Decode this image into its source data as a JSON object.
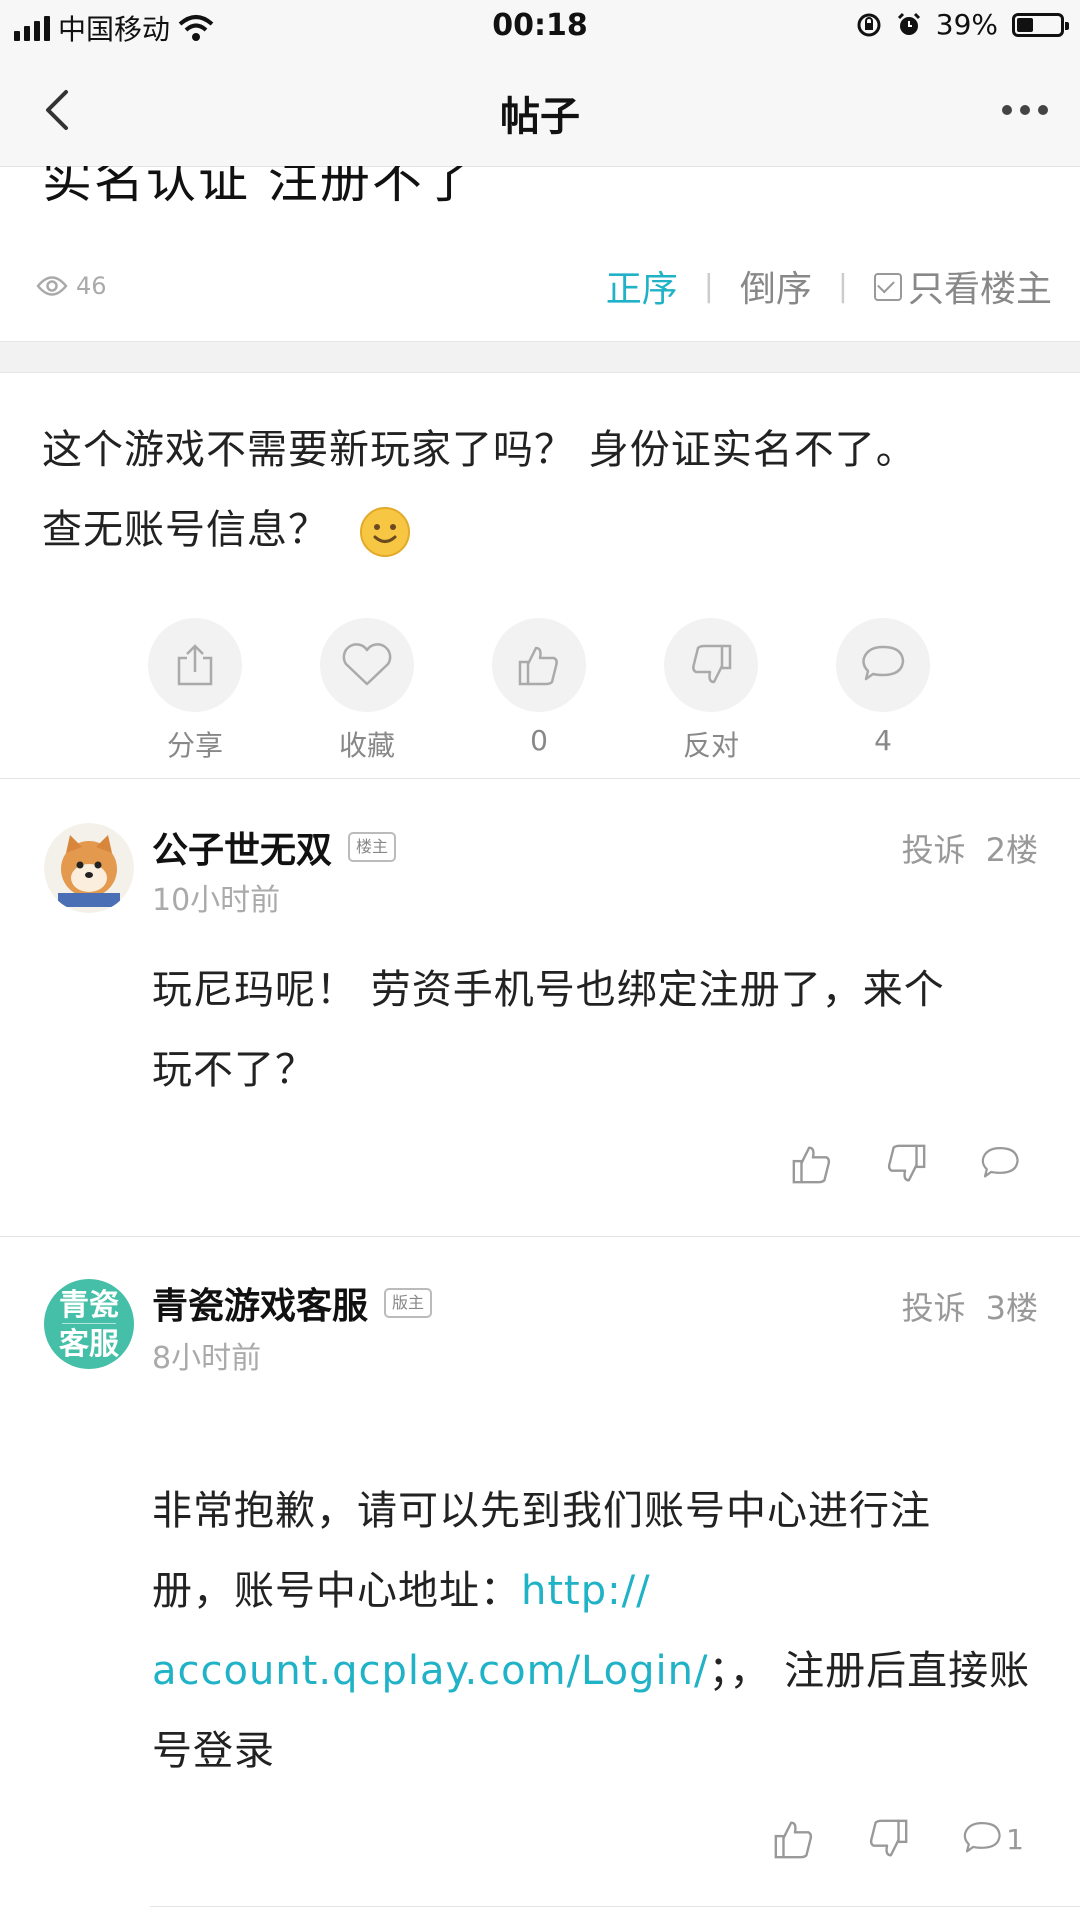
{
  "status_bar": {
    "carrier": "中国移动",
    "time": "00:18",
    "battery_percent": "39%",
    "battery_level": 0.39
  },
  "nav": {
    "title": "帖子"
  },
  "post": {
    "title": "实名认证 注册不了",
    "views": "46",
    "sort": {
      "forward": "正序",
      "reverse": "倒序",
      "owner_only": "只看楼主"
    },
    "body_line1": "这个游戏不需要新玩家了吗？ 身份证实名不了。",
    "body_line2": "查无账号信息？",
    "actions": {
      "share": "分享",
      "collect": "收藏",
      "likes": "0",
      "dislike": "反对",
      "comments": "4"
    }
  },
  "comments": [
    {
      "name": "公子世无双",
      "badge": "楼主",
      "time": "10小时前",
      "report": "投诉",
      "floor": "2楼",
      "line1": "玩尼玛呢！  劳资手机号也绑定注册了，来个",
      "line2": "玩不了？"
    },
    {
      "name": "青瓷游戏客服",
      "badge": "版主",
      "avatar_text": [
        "青瓷",
        "客服"
      ],
      "time": "8小时前",
      "report": "投诉",
      "floor": "3楼",
      "line1": "非常抱歉，请可以先到我们账号中心进行注",
      "line2_prefix": "册，账号中心地址：",
      "link_part1": "http://",
      "link_part2": "account.qcplay.com/Login/",
      "line3_suffix": "；，  注册后直接账",
      "line4": "号登录",
      "reply_count": "1"
    }
  ],
  "colors": {
    "accent": "#20b2c6",
    "avatar_bg": "#45bfa7"
  }
}
